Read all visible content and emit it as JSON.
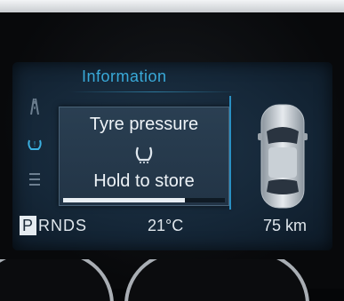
{
  "display": {
    "title": "Information",
    "side_menu": {
      "icons": [
        "road-icon",
        "tyre-pressure-icon",
        "list-icon"
      ]
    },
    "message_card": {
      "line1": "Tyre pressure",
      "icon": "tpms-warning-icon",
      "line2": "Hold to store",
      "hold_progress": 0.75
    },
    "vehicle_icon": "car-top-view-icon",
    "status_bar": {
      "gear_active": "P",
      "gear_rest": "RNDS",
      "temperature": "21°C",
      "range": "75 km"
    }
  },
  "colors": {
    "accent": "#39a9d8",
    "screen_bg": "#152738",
    "card_bg": "#2a3f52",
    "text": "#eef3f7"
  }
}
